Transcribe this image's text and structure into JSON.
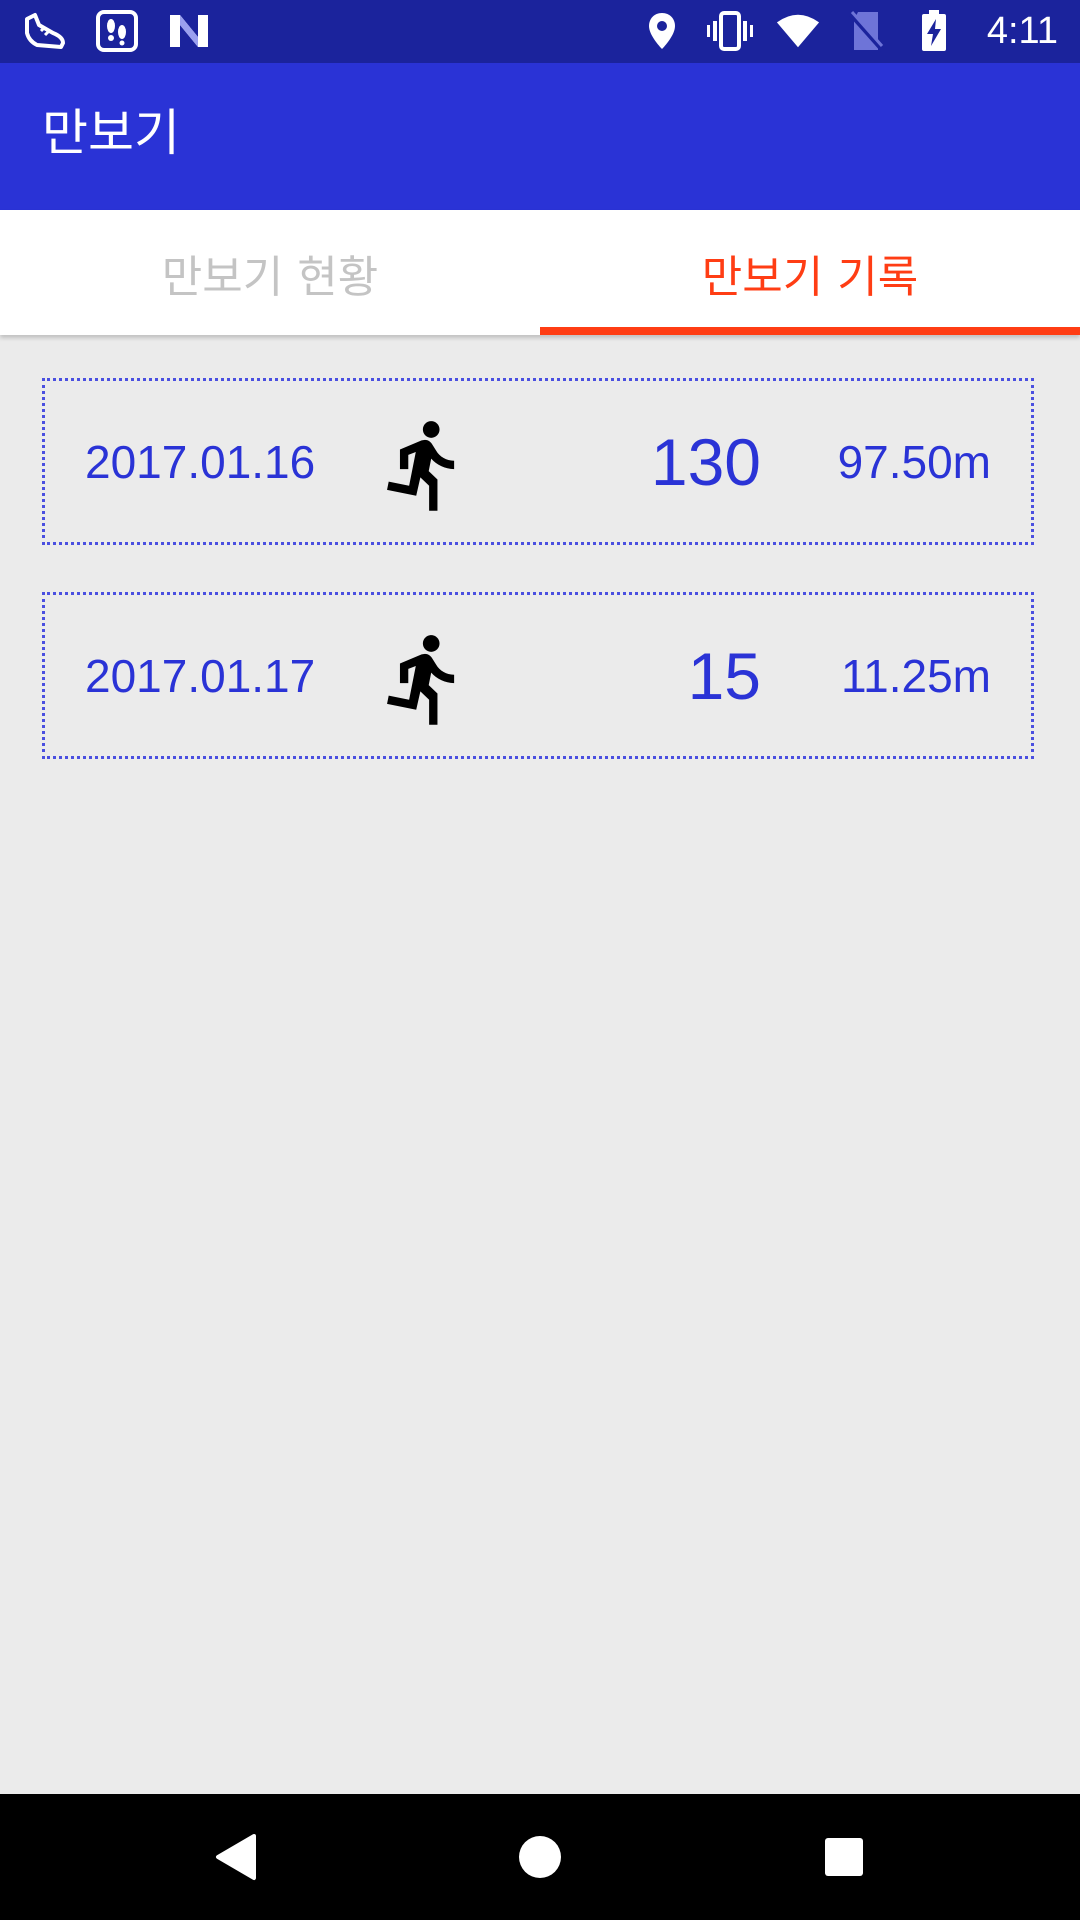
{
  "status_bar": {
    "time": "4:11",
    "left_icons": [
      "shoe-notification-icon",
      "footprints-notification-icon",
      "n-notification-icon"
    ],
    "right_icons": [
      "location-icon",
      "vibrate-icon",
      "wifi-icon",
      "no-sim-icon",
      "battery-charging-icon"
    ]
  },
  "app_bar": {
    "title": "만보기"
  },
  "tabs": [
    {
      "label": "만보기 현황",
      "selected": false
    },
    {
      "label": "만보기 기록",
      "selected": true
    }
  ],
  "records": [
    {
      "date": "2017.01.16",
      "icon": "running-person-icon",
      "steps": "130",
      "distance": "97.50m"
    },
    {
      "date": "2017.01.17",
      "icon": "running-person-icon",
      "steps": "15",
      "distance": "11.25m"
    }
  ],
  "colors": {
    "status_bar": "#1b239c",
    "app_bar": "#2a33d6",
    "accent": "#ff3d14",
    "text_primary": "#2a33d6",
    "tab_inactive": "#c4c4c4",
    "background": "#ebebeb"
  },
  "nav_bar": {
    "buttons": [
      "back-icon",
      "home-icon",
      "recents-icon"
    ]
  }
}
